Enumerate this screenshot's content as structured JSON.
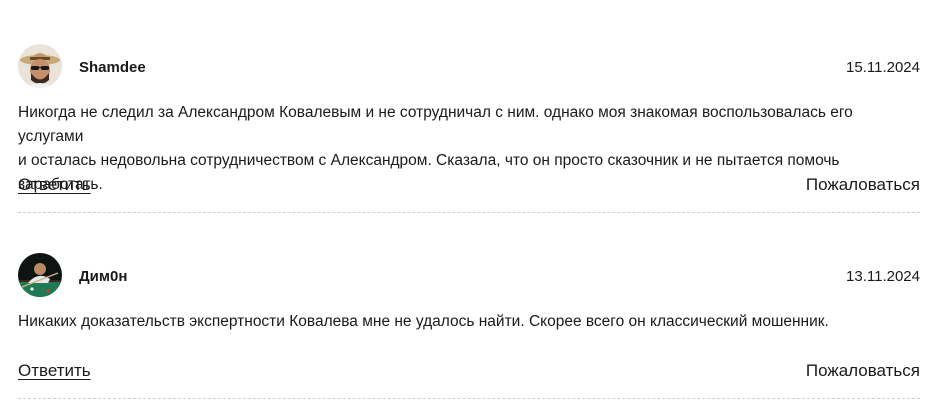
{
  "comments": [
    {
      "author": "Shamdee",
      "date": "15.11.2024",
      "text_lines": [
        "Никогда не следил за Александром Ковалевым и не сотрудничал с ним. однако моя знакомая воспользовалась его услугами",
        "и осталась недовольна сотрудничеством с Александром. Сказала, что он просто сказочник и не пытается помочь заработать."
      ],
      "reply_label": "Ответить",
      "complain_label": "Пожаловаться",
      "avatar_icon": "man-in-hat-avatar-icon"
    },
    {
      "author": "Дим0н",
      "date": "13.11.2024",
      "text_lines": [
        "Никаких доказательств экспертности Ковалева мне не удалось найти. Скорее всего он классический мошенник."
      ],
      "reply_label": "Ответить",
      "complain_label": "Пожаловаться",
      "avatar_icon": "billiards-player-avatar-icon"
    }
  ]
}
